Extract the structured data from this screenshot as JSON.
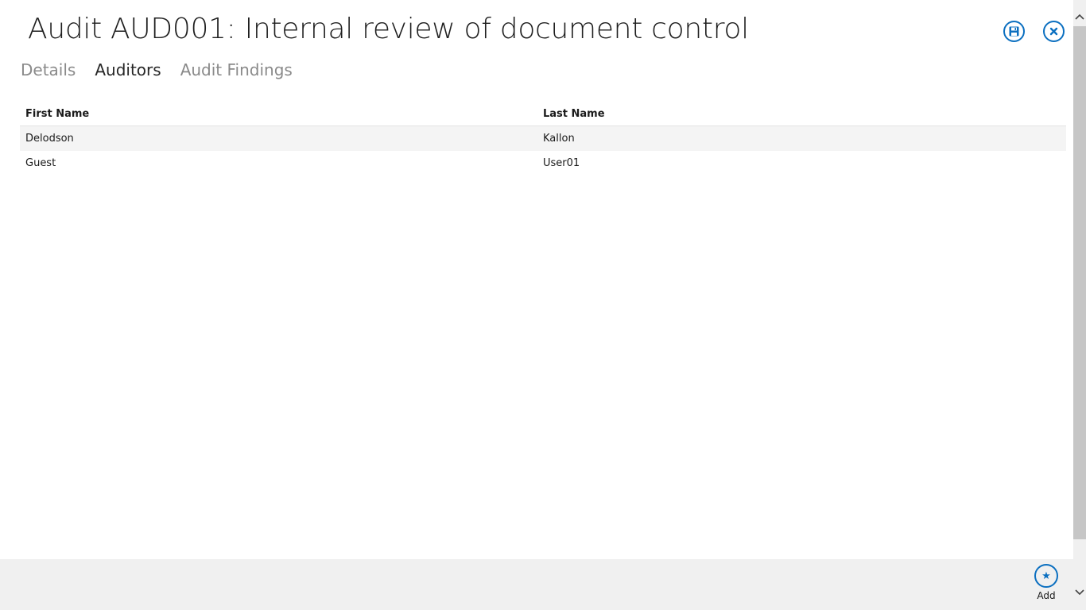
{
  "header": {
    "title": "Audit AUD001: Internal review of document control",
    "save_icon": "save-icon",
    "close_icon": "close-icon",
    "accent_color": "#0b6fc0"
  },
  "tabs": [
    {
      "label": "Details",
      "active": false
    },
    {
      "label": "Auditors",
      "active": true
    },
    {
      "label": "Audit Findings",
      "active": false
    }
  ],
  "grid": {
    "columns": [
      "First Name",
      "Last Name"
    ],
    "rows": [
      {
        "first_name": "Delodson",
        "last_name": "Kallon",
        "selected": true
      },
      {
        "first_name": "Guest",
        "last_name": "User01",
        "selected": false
      }
    ]
  },
  "command_bar": {
    "add_label": "Add",
    "add_icon": "star-icon"
  }
}
